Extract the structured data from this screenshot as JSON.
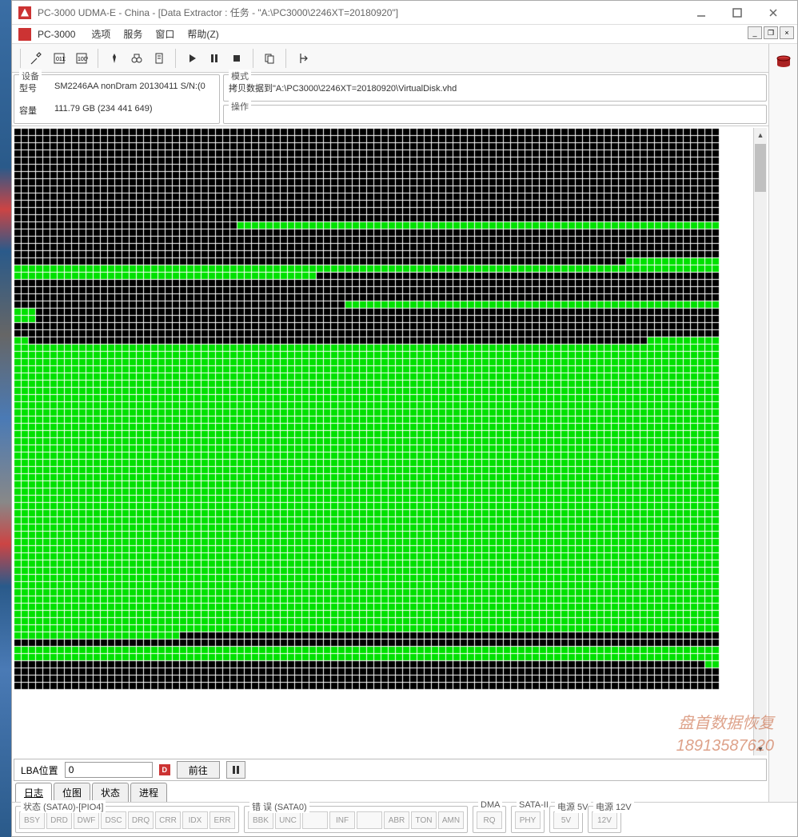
{
  "window": {
    "title": "PC-3000 UDMA-E - China - [Data Extractor : 任务 - \"A:\\PC3000\\2246XT=20180920\"]"
  },
  "menubar": {
    "app_name": "PC-3000",
    "items": [
      "选项",
      "服务",
      "窗口",
      "帮助(Z)"
    ]
  },
  "device": {
    "panel_label": "设备",
    "model_label": "型号",
    "model_value": "SM2246AA nonDram 20130411 S/N:(0",
    "capacity_label": "容量",
    "capacity_value": "111.79 GB (234 441 649)"
  },
  "mode": {
    "panel_label": "模式",
    "value": "拷贝数据到\"A:\\PC3000\\2246XT=20180920\\VirtualDisk.vhd"
  },
  "operation": {
    "panel_label": "操作"
  },
  "lba": {
    "label": "LBA位置",
    "value": "0",
    "goto": "前往"
  },
  "tabs": [
    "日志",
    "位图",
    "状态",
    "进程"
  ],
  "status_groups": {
    "status": {
      "label": "状态 (SATA0)-[PIO4]",
      "items": [
        "BSY",
        "DRD",
        "DWF",
        "DSC",
        "DRQ",
        "CRR",
        "IDX",
        "ERR"
      ]
    },
    "error": {
      "label": "错 误 (SATA0)",
      "items": [
        "BBK",
        "UNC",
        "",
        "INF",
        "",
        "ABR",
        "TON",
        "AMN"
      ]
    },
    "dma": {
      "label": "DMA",
      "items": [
        "RQ"
      ]
    },
    "sata2": {
      "label": "SATA-II",
      "items": [
        "PHY"
      ]
    },
    "pwr5": {
      "label": "电源 5V",
      "items": [
        "5V"
      ]
    },
    "pwr12": {
      "label": "电源 12V",
      "items": [
        "12V"
      ]
    }
  },
  "watermark": {
    "line1": "盘首数据恢复",
    "line2": "18913587620"
  },
  "map": {
    "cols": 98,
    "rows": 78,
    "cell": 9,
    "gap": 1,
    "green": "#00e000",
    "black": "#000000",
    "pattern_comment": "rows: 0-12 black; 13 black0-30 green31-end; 14-17 black; 18 green; 19 green0-40 black41-end; 20-22 black; 23 black0-45 green46-end; 24 green0-2 black3-end; 25-27 black; 28 green0-1 black rest; 29 black0-end green last 10; 30-69 green; 70 green0-22 black23-end; 71 black; 72-73 green; 74 black green last 2; 75-77 black"
  }
}
